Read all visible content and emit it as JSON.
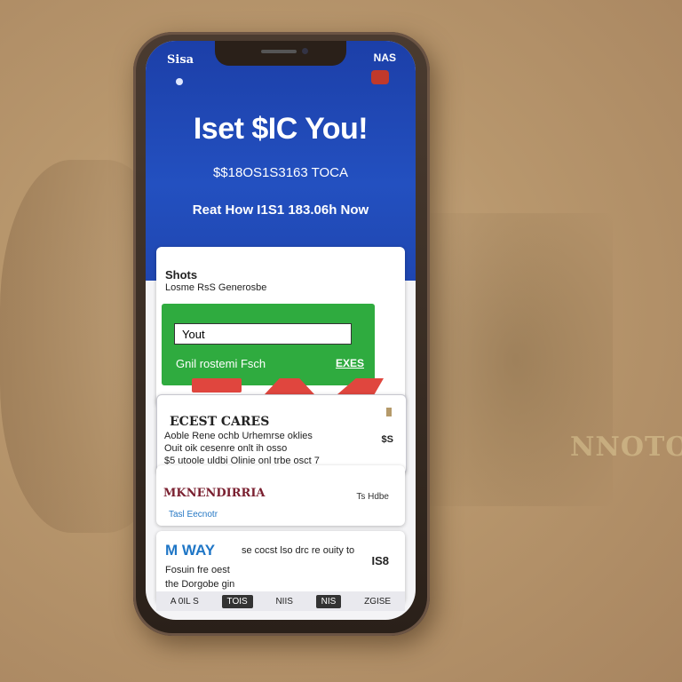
{
  "status": {
    "left": "Sisa",
    "right": "NAS"
  },
  "hero": {
    "title": "Iset $IC You!",
    "subtitle": "$$18OS1S3163 TOCA",
    "cta": "Reat How I1S1 183.06h Now"
  },
  "signup": {
    "title": "Shots",
    "subtitle": "Losme RsS Generosbe",
    "input_value": "Yout",
    "hint": "Gnil rostemi  Fsch",
    "link": "EXES"
  },
  "best_cares": {
    "heading": "ECEST CARES",
    "lines": [
      "Aoble Rene ochb  Urhemrse oklies",
      "Ouit  oik   cesenre  onlt  ih  osso",
      "$5 utoole uldbi  Olinie  onl  trbe  osct 7"
    ],
    "badge": "$S"
  },
  "promo": {
    "heading": "MKNENDIRRIA",
    "tag": "Ts Hdbe",
    "link": "Tasl  Eecnotr"
  },
  "market": {
    "brand": "M  WAY",
    "line1": "se cocst lso drc re ouity to",
    "line2": "Fosuin fre oest",
    "line3": "the Dorgobe gin",
    "price": "IS8"
  },
  "tabs": [
    "A 0IL S",
    "TOIS",
    "NIIS",
    "NIS",
    "ZGISE"
  ],
  "floor_text": "NNOTO"
}
